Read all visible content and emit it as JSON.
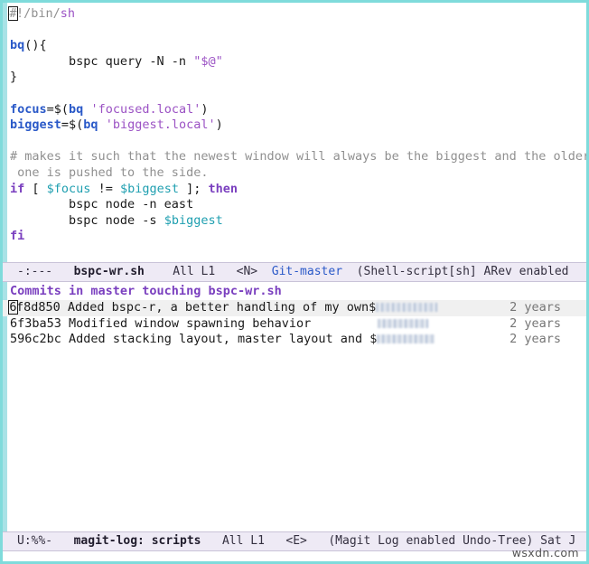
{
  "window": {
    "border_color": "#7fdbdb",
    "background": "#ffffff"
  },
  "editor": {
    "fringe_color": "#a9e2e6",
    "cursor_char": "#",
    "lines": [
      {
        "tokens": [
          {
            "t": "#",
            "c": "comment",
            "cursor": true
          },
          {
            "t": "!/bin/",
            "c": "comment"
          },
          {
            "t": "sh",
            "c": "string"
          }
        ]
      },
      {
        "tokens": []
      },
      {
        "tokens": [
          {
            "t": "bq",
            "c": "func"
          },
          {
            "t": "(){",
            "c": "punct"
          }
        ]
      },
      {
        "tokens": [
          {
            "t": "        bspc query -N -n ",
            "c": "plain"
          },
          {
            "t": "\"$@\"",
            "c": "string"
          }
        ]
      },
      {
        "tokens": [
          {
            "t": "}",
            "c": "punct"
          }
        ]
      },
      {
        "tokens": []
      },
      {
        "tokens": [
          {
            "t": "focus",
            "c": "var"
          },
          {
            "t": "=$(",
            "c": "plain"
          },
          {
            "t": "bq",
            "c": "func"
          },
          {
            "t": " ",
            "c": "plain"
          },
          {
            "t": "'focused.local'",
            "c": "string"
          },
          {
            "t": ")",
            "c": "plain"
          }
        ]
      },
      {
        "tokens": [
          {
            "t": "biggest",
            "c": "var"
          },
          {
            "t": "=$(",
            "c": "plain"
          },
          {
            "t": "bq",
            "c": "func"
          },
          {
            "t": " ",
            "c": "plain"
          },
          {
            "t": "'biggest.local'",
            "c": "string"
          },
          {
            "t": ")",
            "c": "plain"
          }
        ]
      },
      {
        "tokens": []
      },
      {
        "tokens": [
          {
            "t": "# makes it such that the newest window will always be the biggest and the older\\",
            "c": "comment"
          }
        ]
      },
      {
        "tokens": [
          {
            "t": " one is pushed to the side.",
            "c": "comment"
          }
        ]
      },
      {
        "tokens": [
          {
            "t": "if",
            "c": "keyword"
          },
          {
            "t": " [ ",
            "c": "plain"
          },
          {
            "t": "$focus",
            "c": "varref"
          },
          {
            "t": " != ",
            "c": "plain"
          },
          {
            "t": "$biggest",
            "c": "varref"
          },
          {
            "t": " ]; ",
            "c": "plain"
          },
          {
            "t": "then",
            "c": "keyword"
          }
        ]
      },
      {
        "tokens": [
          {
            "t": "        bspc node -n east",
            "c": "plain"
          }
        ]
      },
      {
        "tokens": [
          {
            "t": "        bspc node -s ",
            "c": "plain"
          },
          {
            "t": "$biggest",
            "c": "varref"
          }
        ]
      },
      {
        "tokens": [
          {
            "t": "fi",
            "c": "keyword"
          }
        ]
      }
    ]
  },
  "editor_modeline": {
    "status": "-:---",
    "buffer": "bspc-wr.sh",
    "position": "All L1",
    "input_method": "<N>",
    "vcs": "Git-master",
    "major_mode": "(Shell-script[sh] ARev enabled",
    "vcs_color": "#2a59c8"
  },
  "magit": {
    "header": "Commits in master touching bspc-wr.sh",
    "commits": [
      {
        "hash": "6f8d850",
        "subject": "Added bspc-r, a better handling of my own$",
        "author_redacted_width": 68,
        "age": "2 years",
        "selected": true,
        "cursor_on_hash": true
      },
      {
        "hash": "6f3ba53",
        "subject": "Modified window spawning behavior",
        "author_redacted_width": 56,
        "author_gap": 74,
        "age": "2 years",
        "selected": false,
        "cursor_on_hash": false
      },
      {
        "hash": "596c2bc",
        "subject": "Added stacking layout, master layout and $",
        "author_redacted_width": 64,
        "age": "2 years",
        "selected": false,
        "cursor_on_hash": false
      }
    ]
  },
  "magit_modeline": {
    "status": "U:%%-",
    "buffer": "magit-log: scripts",
    "position": "All L1",
    "input_method": "<E>",
    "major_mode": "(Magit Log enabled Undo-Tree) Sat J"
  },
  "watermark": {
    "text": "wsxdn.com"
  }
}
